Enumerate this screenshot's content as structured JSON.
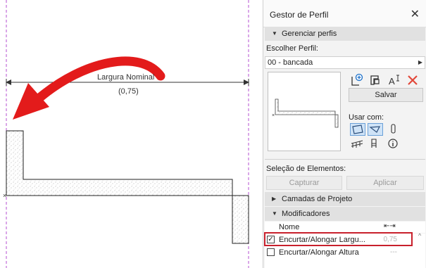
{
  "canvas": {
    "dimension_text": "Largura Nominal",
    "dimension_value": "(0,75)"
  },
  "panel": {
    "title": "Gestor de Perfil",
    "sections": {
      "manage": "Gerenciar perfis",
      "project_layers": "Camadas de Projeto",
      "modifiers": "Modificadores"
    },
    "choose_profile_label": "Escolher Perfil:",
    "selected_profile": "00 - bancada",
    "save_button": "Salvar",
    "use_with_label": "Usar com:",
    "element_selection_label": "Seleção de Elementos:",
    "capture_button": "Capturar",
    "apply_button": "Aplicar",
    "modifiers_table": {
      "name_header": "Nome",
      "rows": [
        {
          "label": "Encurtar/Alongar Largu...",
          "value": "0,75",
          "checked": true
        },
        {
          "label": "Encurtar/Alongar Altura",
          "value": "---",
          "checked": false
        }
      ]
    }
  },
  "icons": {
    "close": "close-icon",
    "new_profile": "new-profile-icon",
    "duplicate_profile": "duplicate-profile-icon",
    "rename_profile": "rename-icon",
    "delete_profile": "delete-icon",
    "wall_tool": "wall-tool-icon",
    "beam_tool": "beam-tool-icon",
    "column_tool": "column-tool-icon",
    "railing_tool": "railing-tool-icon",
    "object_tool": "object-tool-icon",
    "info": "info-icon"
  },
  "colors": {
    "arrow": "#e31b1b",
    "highlight": "#c8202c",
    "guide": "#b44fd0",
    "toggle_on": "#cfe3f7"
  }
}
